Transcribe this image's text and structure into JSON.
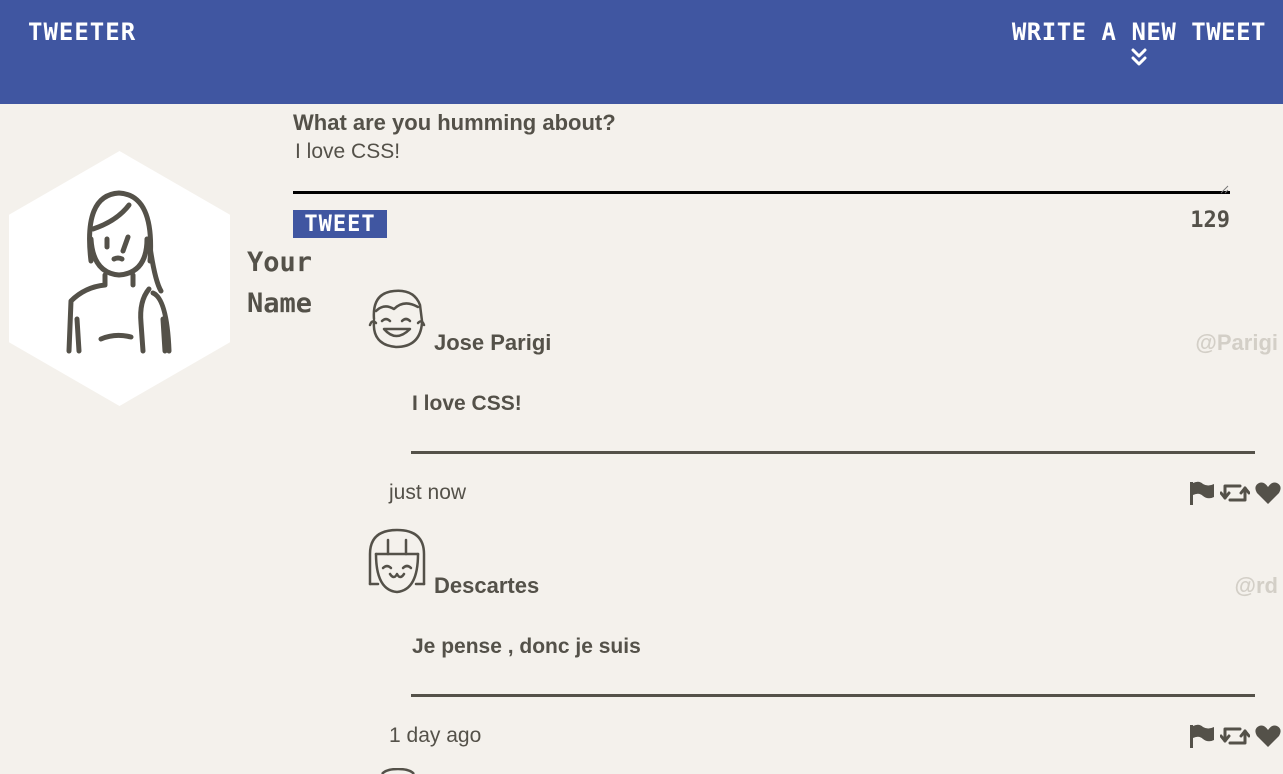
{
  "nav": {
    "brand": "TWEETER",
    "compose_toggle": "WRITE A NEW TWEET"
  },
  "compose": {
    "prompt": "What are you humming about?",
    "text": "I love CSS!",
    "button_label": "TWEET",
    "counter": "129"
  },
  "profile": {
    "name_first": "Your",
    "name_last": "Name"
  },
  "tweets": [
    {
      "author": "Jose Parigi",
      "handle": "@Parigi",
      "content": "I love CSS!",
      "time": "just now"
    },
    {
      "author": "Descartes",
      "handle": "@rd",
      "content": "Je pense , donc je suis",
      "time": "1 day ago"
    }
  ],
  "icons": [
    "chevrons-down-icon",
    "profile-avatar-icon",
    "flag-icon",
    "retweet-icon",
    "heart-icon"
  ],
  "colors": {
    "nav_bg": "#4056a1",
    "page_bg": "#f4f1ec",
    "text": "#545149",
    "handle": "#d3cfc7"
  }
}
